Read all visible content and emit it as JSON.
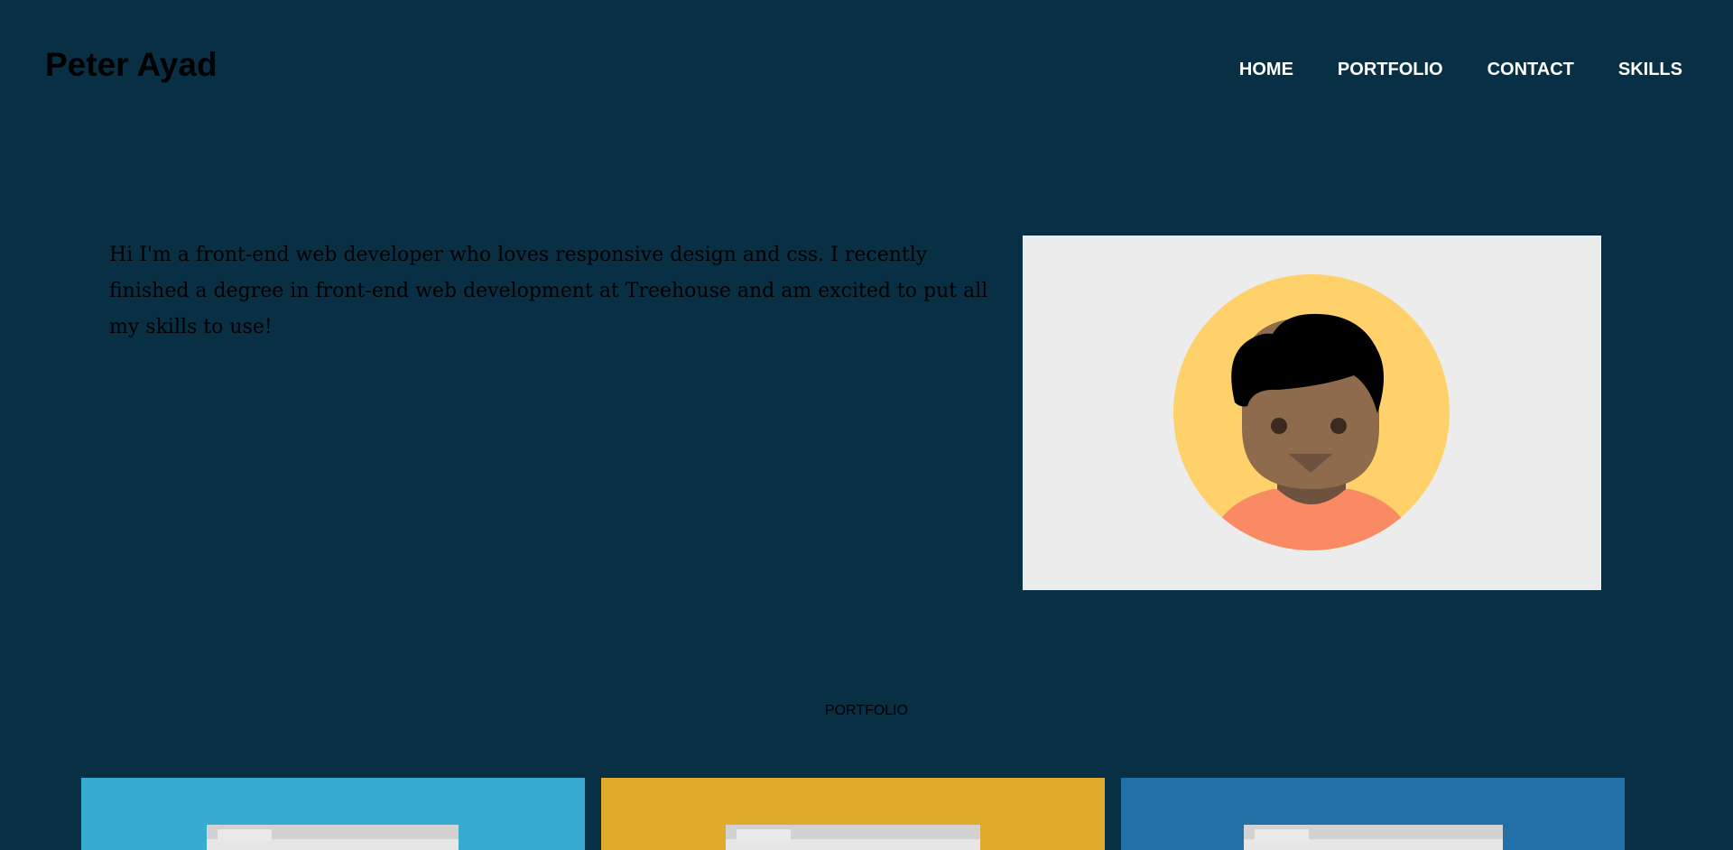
{
  "header": {
    "logo": "Peter Ayad",
    "nav": [
      {
        "label": "HOME"
      },
      {
        "label": "PORTFOLIO"
      },
      {
        "label": "CONTACT"
      },
      {
        "label": "SKILLS"
      }
    ]
  },
  "intro": {
    "text": "Hi I'm a front-end web developer who loves responsive design and css. I recently finished a degree in front-end web development at Treehouse and am excited to put all my skills to use!"
  },
  "avatar": {
    "icon": "avatar-icon"
  },
  "portfolio": {
    "title": "PORTFOLIO",
    "cards": [
      {
        "color": "#37abd0"
      },
      {
        "color": "#deab2a"
      },
      {
        "color": "#2370a9"
      }
    ]
  },
  "colors": {
    "background": "#082f44",
    "nav_text": "#ffffff",
    "avatar_bg": "#ececec",
    "avatar_circle": "#ffd16a",
    "skin": "#8e6b4d",
    "shirt": "#f98a63"
  }
}
